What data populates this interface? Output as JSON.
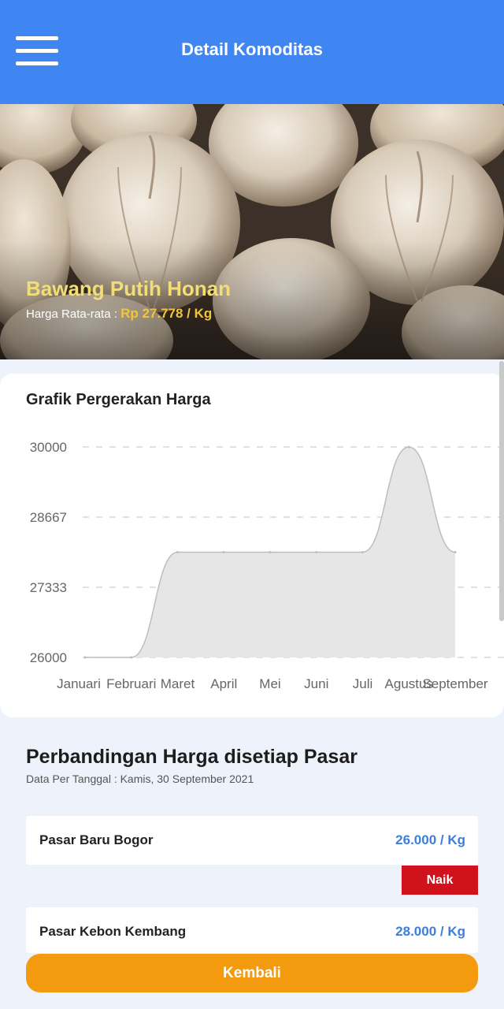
{
  "header": {
    "title": "Detail Komoditas",
    "menu_icon": "hamburger-menu-icon"
  },
  "hero": {
    "name": "Bawang Putih Honan",
    "price_label": "Harga Rata-rata : ",
    "price_value": "Rp 27.778 / Kg",
    "image": "garlic-photo"
  },
  "chart": {
    "title": "Grafik Pergerakan Harga"
  },
  "chart_data": {
    "type": "area",
    "title": "Grafik Pergerakan Harga",
    "xlabel": "",
    "ylabel": "",
    "categories": [
      "Januari",
      "Februari",
      "Maret",
      "April",
      "Mei",
      "Juni",
      "Juli",
      "Agustus",
      "September"
    ],
    "values": [
      26000,
      26000,
      28000,
      28000,
      28000,
      28000,
      28000,
      30000,
      28000
    ],
    "yticks": [
      "30000",
      "28667",
      "27333",
      "26000"
    ],
    "ylim": [
      26000,
      30000
    ],
    "grid": true,
    "fill_color": "#e6e6e6",
    "line_color": "#bdbdbd"
  },
  "compare": {
    "title": "Perbandingan Harga disetiap Pasar",
    "date": "Data Per Tanggal : Kamis, 30 September 2021",
    "markets": [
      {
        "name": "Pasar Baru Bogor",
        "price": "26.000 / Kg",
        "badge": "Naik"
      },
      {
        "name": "Pasar Kebon Kembang",
        "price": "28.000 / Kg"
      }
    ]
  },
  "footer": {
    "back_label": "Kembali"
  },
  "colors": {
    "header": "#3f86f3",
    "accent_orange": "#f39a0f",
    "badge_red": "#cf121c",
    "price_blue": "#3b7fd9",
    "hero_name": "#f3dd76"
  }
}
